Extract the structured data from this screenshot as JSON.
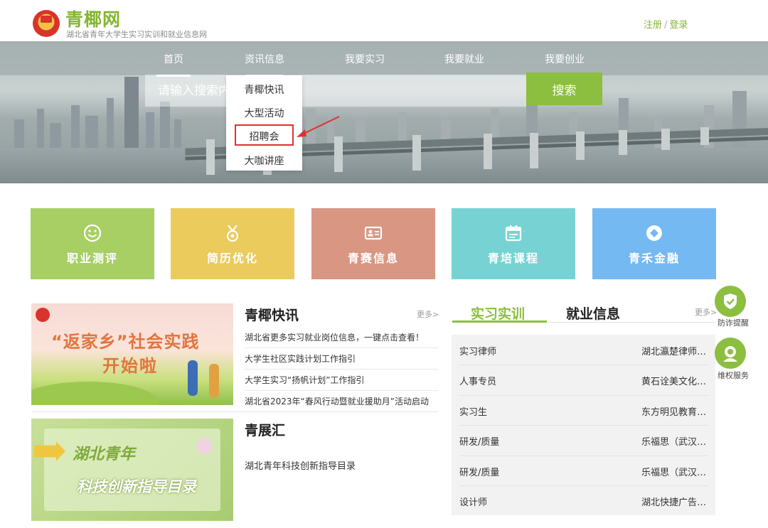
{
  "header": {
    "site_title": "青椰网",
    "site_subtitle": "湖北省青年大学生实习实训和就业信息网",
    "register": "注册",
    "separator": "/",
    "login": "登录"
  },
  "nav": {
    "items": [
      "首页",
      "资讯信息",
      "我要实习",
      "我要就业",
      "我要创业"
    ]
  },
  "search": {
    "placeholder": "请输入搜索内容",
    "button": "搜索"
  },
  "dropdown": {
    "items": [
      "青椰快讯",
      "大型活动",
      "招聘会",
      "大咖讲座"
    ]
  },
  "tiles": [
    {
      "label": "职业测评",
      "icon": "smiley-icon",
      "color": "#a8cf64"
    },
    {
      "label": "简历优化",
      "icon": "medal-icon",
      "color": "#ebcb5c"
    },
    {
      "label": "青赛信息",
      "icon": "id-card-icon",
      "color": "#d99683"
    },
    {
      "label": "青培课程",
      "icon": "calendar-icon",
      "color": "#77d3d3"
    },
    {
      "label": "青禾金融",
      "icon": "diamond-icon",
      "color": "#75b9f2"
    }
  ],
  "news": {
    "title": "青椰快讯",
    "more": "更多>",
    "image1_text": "“返家乡”社会实践",
    "image1_text2": "开始啦",
    "items": [
      "湖北省更多实习就业岗位信息，一键点击查看！",
      "大学生社区实践计划工作指引",
      "大学生实习“扬帆计划”工作指引",
      "湖北省2023年“春风行动暨就业援助月”活动启动"
    ]
  },
  "showcase": {
    "title": "青展汇",
    "item": "湖北青年科技创新指导目录",
    "image2_text": "湖北青年",
    "image2_text2": "科技创新指导目录"
  },
  "jobs": {
    "tab_active": "实习实训",
    "tab_inactive": "就业信息",
    "more": "更多>",
    "rows": [
      {
        "title": "实习律师",
        "company": "湖北瀛楚律师…"
      },
      {
        "title": "人事专员",
        "company": "黄石诠美文化…"
      },
      {
        "title": "实习生",
        "company": "东方明见教育…"
      },
      {
        "title": "研发/质量",
        "company": "乐福思（武汉…"
      },
      {
        "title": "研发/质量",
        "company": "乐福思（武汉…"
      },
      {
        "title": "设计师",
        "company": "湖北快捷广告…"
      }
    ]
  },
  "side": {
    "fraud_alert": "防诈提醒",
    "rights_service": "维权服务"
  },
  "colors": {
    "brand_green": "#8cbe3f",
    "title_green": "#84b52f",
    "highlight_red": "#e03030"
  }
}
